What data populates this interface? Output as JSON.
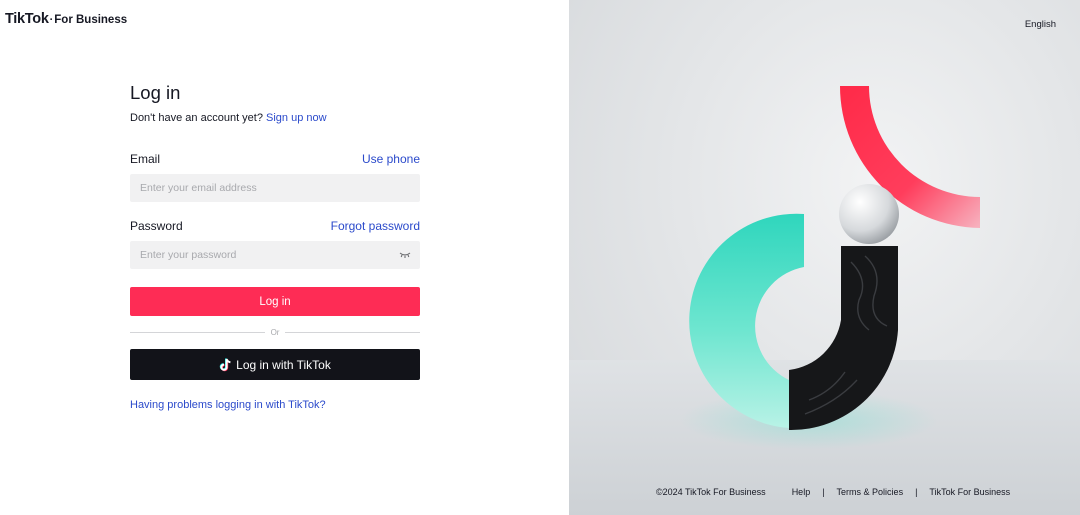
{
  "brand": {
    "main": "TikTok",
    "dot": "·",
    "sub": "For Business"
  },
  "login": {
    "heading": "Log in",
    "signup_prompt": "Don't have an account yet?",
    "signup_link": "Sign up now",
    "email": {
      "label": "Email",
      "alt_link": "Use phone",
      "placeholder": "Enter your email address",
      "value": ""
    },
    "password": {
      "label": "Password",
      "alt_link": "Forgot password",
      "placeholder": "Enter your password",
      "value": ""
    },
    "login_button": "Log in",
    "divider": "Or",
    "tiktok_button": "Log in with TikTok",
    "help_link": "Having problems logging in with TikTok?"
  },
  "language": "English",
  "footer": {
    "copyright": "©2024 TikTok For Business",
    "links": [
      "Help",
      "Terms & Policies",
      "TikTok For Business"
    ]
  },
  "icons": {
    "password_toggle": "eye-closed-icon",
    "tiktok_button_icon": "tiktok-note-icon"
  },
  "colors": {
    "primary": "#fe2c55",
    "link": "#2b4acb",
    "dark_button": "#121319",
    "input_bg": "#f1f1f2"
  }
}
